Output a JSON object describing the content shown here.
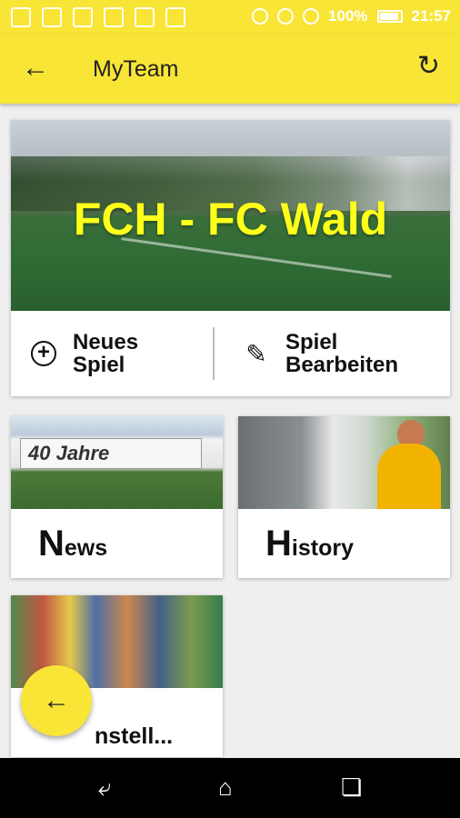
{
  "status_bar": {
    "battery": "100%",
    "time": "21:57"
  },
  "app_bar": {
    "title": "MyTeam",
    "back_icon": "arrow-back-icon",
    "refresh_icon": "refresh-icon"
  },
  "match_card": {
    "title": "FCH - FC Wald",
    "actions": [
      {
        "label": "Neues Spiel",
        "icon": "add-circle-icon"
      },
      {
        "label": "Spiel Bearbeiten",
        "icon": "pencil-icon"
      }
    ]
  },
  "tiles": [
    {
      "label_initial": "N",
      "label_rest": "ews",
      "banner": "40 Jahre"
    },
    {
      "label_initial": "H",
      "label_rest": "istory"
    },
    {
      "label_initial": "",
      "label_rest": "nstell..."
    }
  ],
  "fab": {
    "icon": "arrow-back-icon"
  },
  "nav_bar": {
    "items": [
      "back-icon",
      "home-icon",
      "recents-icon"
    ]
  },
  "colors": {
    "accent": "#f9e536",
    "title_yellow": "#ffff1a"
  }
}
